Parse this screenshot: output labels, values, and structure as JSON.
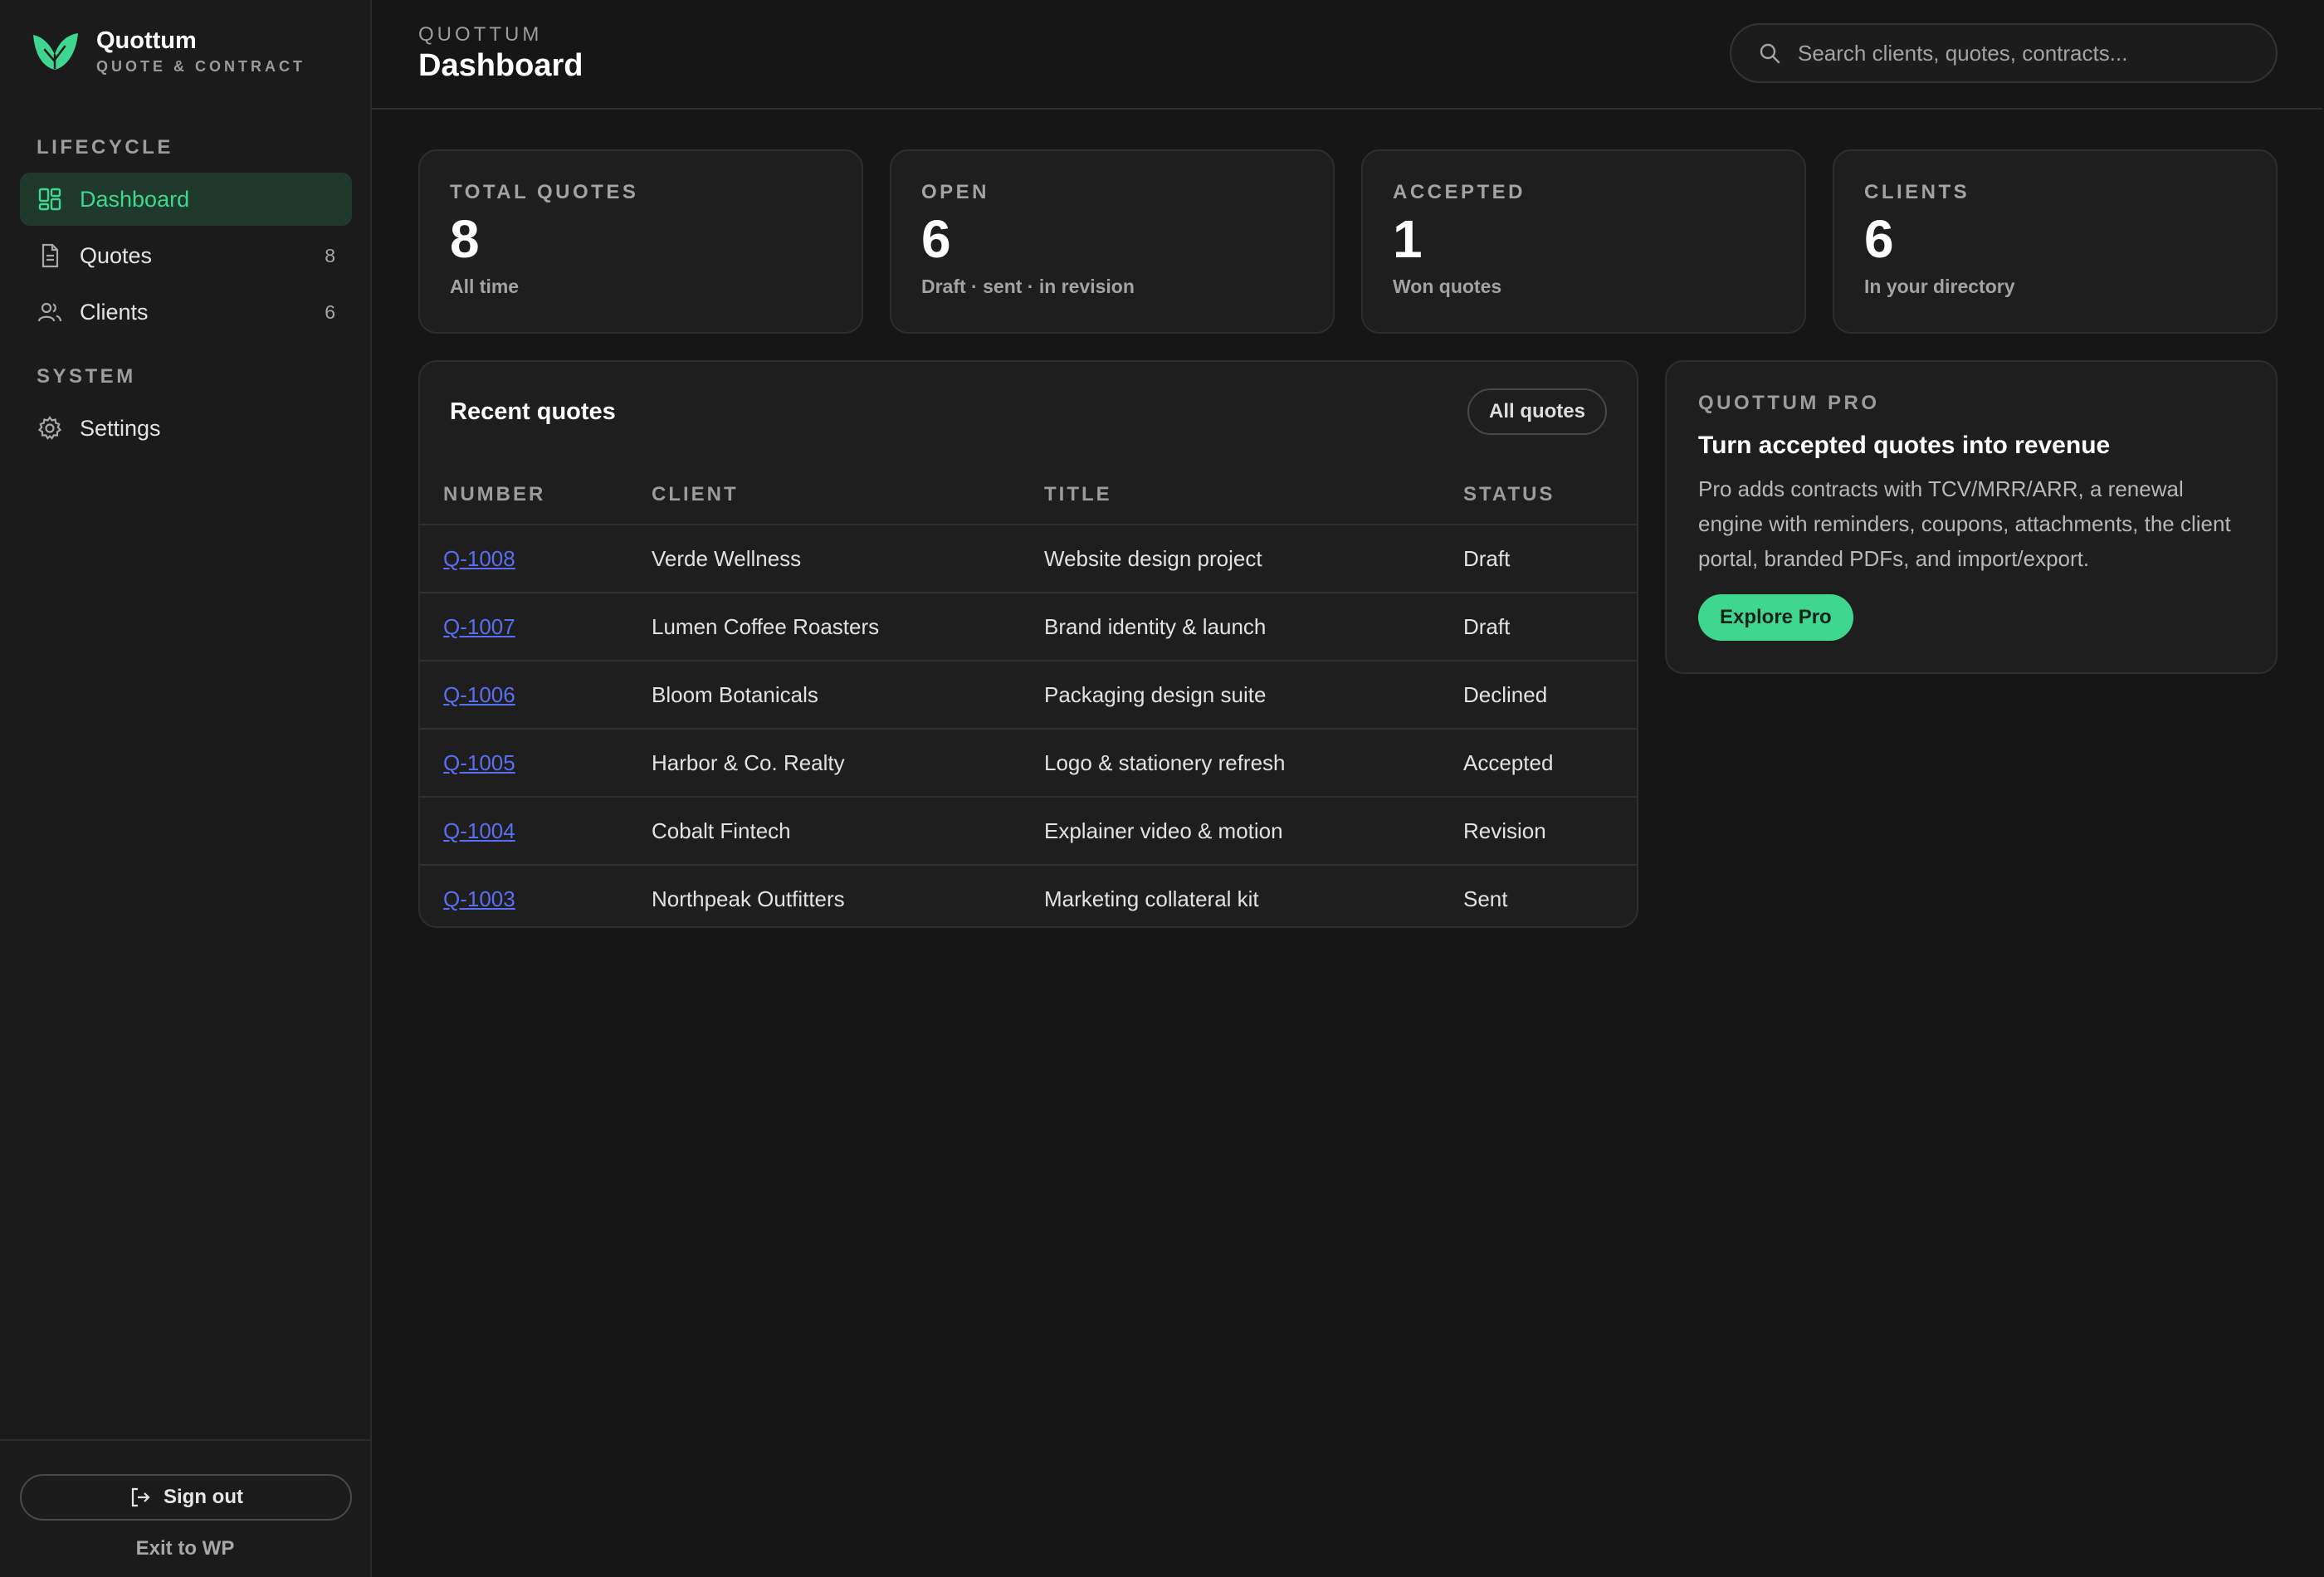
{
  "brand": {
    "name": "Quottum",
    "subtitle": "QUOTE & CONTRACT",
    "logo_icon": "leaf-icon",
    "accent": "#3fd68f"
  },
  "sidebar": {
    "sections": [
      {
        "title": "LIFECYCLE",
        "items": [
          {
            "label": "Dashboard",
            "icon": "dashboard-icon",
            "active": true
          },
          {
            "label": "Quotes",
            "icon": "document-icon",
            "count": "8"
          },
          {
            "label": "Clients",
            "icon": "users-icon",
            "count": "6"
          }
        ]
      },
      {
        "title": "SYSTEM",
        "items": [
          {
            "label": "Settings",
            "icon": "gear-icon"
          }
        ]
      }
    ],
    "footer": {
      "sign_out": "Sign out",
      "exit": "Exit to WP"
    }
  },
  "header": {
    "eyebrow": "QUOTTUM",
    "title": "Dashboard",
    "search_placeholder": "Search clients, quotes, contracts..."
  },
  "stats": [
    {
      "label": "TOTAL QUOTES",
      "value": "8",
      "sub": "All time"
    },
    {
      "label": "OPEN",
      "value": "6",
      "sub": "Draft · sent · in revision"
    },
    {
      "label": "ACCEPTED",
      "value": "1",
      "sub": "Won quotes"
    },
    {
      "label": "CLIENTS",
      "value": "6",
      "sub": "In your directory"
    }
  ],
  "recent_quotes": {
    "title": "Recent quotes",
    "button": "All quotes",
    "columns": [
      "NUMBER",
      "CLIENT",
      "TITLE",
      "STATUS"
    ],
    "rows": [
      {
        "number": "Q-1008",
        "client": "Verde Wellness",
        "title": "Website design project",
        "status": "Draft"
      },
      {
        "number": "Q-1007",
        "client": "Lumen Coffee Roasters",
        "title": "Brand identity & launch",
        "status": "Draft"
      },
      {
        "number": "Q-1006",
        "client": "Bloom Botanicals",
        "title": "Packaging design suite",
        "status": "Declined"
      },
      {
        "number": "Q-1005",
        "client": "Harbor & Co. Realty",
        "title": "Logo & stationery refresh",
        "status": "Accepted"
      },
      {
        "number": "Q-1004",
        "client": "Cobalt Fintech",
        "title": "Explainer video & motion",
        "status": "Revision"
      },
      {
        "number": "Q-1003",
        "client": "Northpeak Outfitters",
        "title": "Marketing collateral kit",
        "status": "Sent"
      }
    ]
  },
  "pro": {
    "eyebrow": "QUOTTUM PRO",
    "title": "Turn accepted quotes into revenue",
    "body": "Pro adds contracts with TCV/MRR/ARR, a renewal engine with reminders, coupons, attachments, the client portal, branded PDFs, and import/export.",
    "button": "Explore Pro"
  }
}
